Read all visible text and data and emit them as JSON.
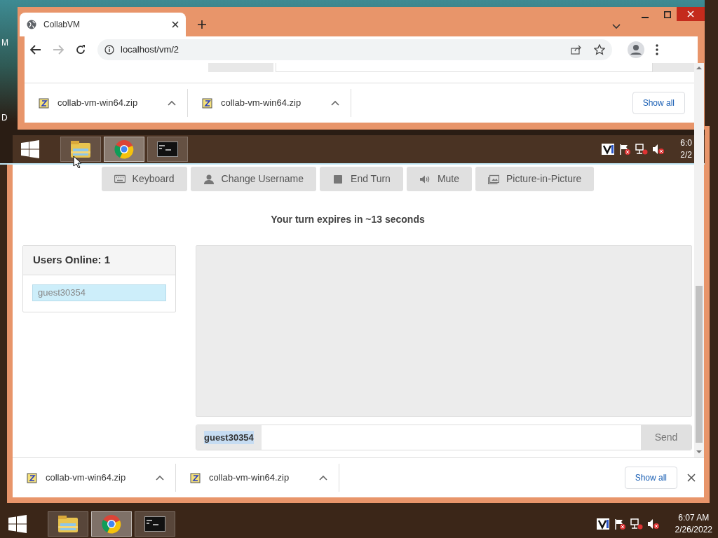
{
  "vm_screen": {
    "desktop_labels": [
      "M",
      "D"
    ],
    "browser": {
      "tabs": [
        {
          "title": "CollabVM",
          "selected": true
        }
      ],
      "address": "localhost/vm/2",
      "downloads": [
        {
          "filename": "collab-vm-win64.zip"
        },
        {
          "filename": "collab-vm-win64.zip"
        }
      ],
      "show_all": "Show all"
    },
    "taskbar": {
      "apps": [
        {
          "kind": "explorer",
          "active": false
        },
        {
          "kind": "chrome",
          "active": true
        },
        {
          "kind": "terminal",
          "active": false
        }
      ],
      "time": "6:0",
      "date": "2/2"
    }
  },
  "toolbar": [
    {
      "kind": "keyboard",
      "label": "Keyboard"
    },
    {
      "kind": "user",
      "label": "Change Username"
    },
    {
      "kind": "stop",
      "label": "End Turn"
    },
    {
      "kind": "speaker",
      "label": "Mute"
    },
    {
      "kind": "pip",
      "label": "Picture-in-Picture"
    }
  ],
  "turn_status": "Your turn expires in ~13 seconds",
  "users_panel": {
    "title": "Users Online: 1",
    "users": [
      {
        "name": "guest30354",
        "selected": true
      }
    ]
  },
  "chat": {
    "username": "guest30354",
    "send": "Send"
  },
  "downloads": [
    {
      "filename": "collab-vm-win64.zip"
    },
    {
      "filename": "collab-vm-win64.zip"
    }
  ],
  "show_all": "Show all",
  "taskbar": {
    "apps": [
      {
        "kind": "explorer",
        "active": false
      },
      {
        "kind": "chrome",
        "active": true
      },
      {
        "kind": "terminal",
        "active": false
      }
    ],
    "time": "6:07 AM",
    "date": "2/26/2022"
  }
}
